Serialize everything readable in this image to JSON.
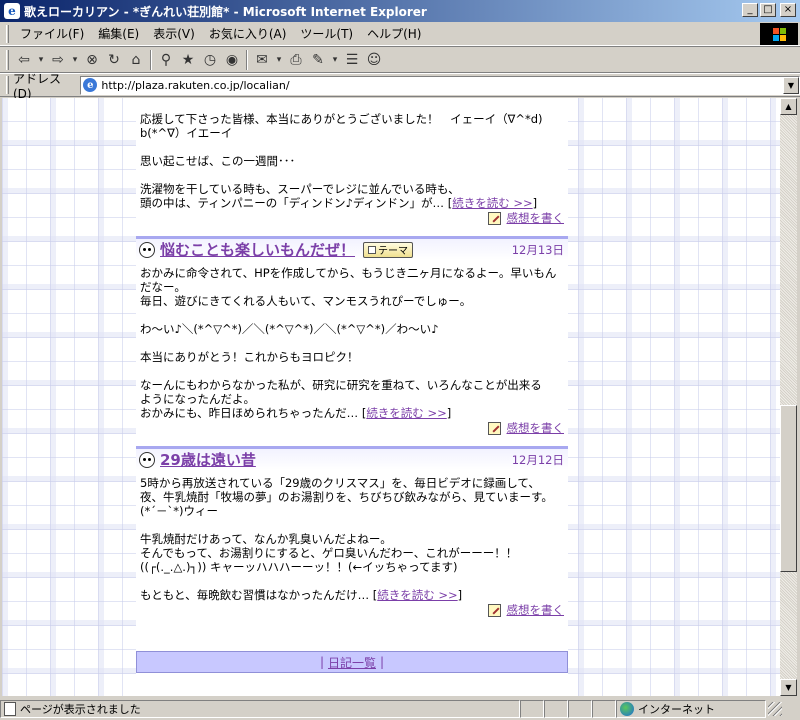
{
  "window": {
    "title": "歌えローカリアン - *ぎんれい荘別館* - Microsoft Internet Explorer",
    "minimize": "_",
    "maximize": "□",
    "close": "×"
  },
  "menu": {
    "items": [
      "ファイル(F)",
      "編集(E)",
      "表示(V)",
      "お気に入り(A)",
      "ツール(T)",
      "ヘルプ(H)"
    ]
  },
  "toolbar": {
    "back": "⇦",
    "forward": "⇨",
    "stop": "⊗",
    "refresh": "↻",
    "home": "⌂",
    "search": "⚲",
    "favorites": "★",
    "history": "◷",
    "media": "◉",
    "mail": "✉",
    "print": "⎙",
    "edit": "✎",
    "discuss": "☰",
    "messenger": "☺",
    "dropdown": "▾"
  },
  "address": {
    "label": "アドレス(D)",
    "url": "http://plaza.rakuten.co.jp/localian/",
    "dropdown": "▼"
  },
  "entries": [
    {
      "lines": [
        "応援して下さった皆様、本当にありがとうございました！　イェーイ（∇^*d)",
        "b(*^∇）イエーイ",
        "",
        "思い起こせば、この一週間･･･",
        "",
        "洗濯物を干している時も、スーパーでレジに並んでいる時も、",
        "頭の中は、ティンパニーの「ディンドン♪ディンドン」が…"
      ],
      "more_label": "続きを読む >>",
      "comment_label": "感想を書く"
    },
    {
      "title": "悩むことも楽しいもんだぜ！",
      "theme_label": "テーマ",
      "date": "12月13日",
      "lines": [
        "おかみに命令されて、HPを作成してから、もうじき二ヶ月になるよー。早いもん",
        "だなー。",
        "毎日、遊びにきてくれる人もいて、マンモスうれぴーでしゅー。",
        "",
        "わ～い♪＼(*^▽^*)／＼(*^▽^*)／＼(*^▽^*)／わ～い♪",
        "",
        "本当にありがとう！これからもヨロピク！",
        "",
        "なーんにもわからなかった私が、研究に研究を重ねて、いろんなことが出来る",
        "ようになったんだよ。",
        "おかみにも、昨日ほめられちゃったんだ…"
      ],
      "more_label": "続きを読む >>",
      "comment_label": "感想を書く"
    },
    {
      "title": "29歳は遠い昔",
      "date": "12月12日",
      "lines": [
        "5時から再放送されている「29歳のクリスマス」を、毎日ビデオに録画して、",
        "夜、牛乳焼酎「牧場の夢」のお湯割りを、ちびちび飲みながら、見ていまーす。",
        "(*´－`*)ウィー",
        "",
        "牛乳焼酎だけあって、なんか乳臭いんだよねー。",
        "そんでもって、お湯割りにすると、ゲロ臭いんだわー、これがーーー！！",
        "((┌(._.△.)┐)) キャーッハハハーーッ！！(←イッちゃってます)",
        "",
        "もともと、毎晩飲む習慣はなかったんだけ…"
      ],
      "more_label": "続きを読む >>",
      "comment_label": "感想を書く"
    }
  ],
  "footer": {
    "sep": "|",
    "diary_list": "日記一覧"
  },
  "status": {
    "text": "ページが表示されました",
    "zone": "インターネット"
  },
  "scroll": {
    "up": "▲",
    "down": "▼",
    "position_fraction": 0.73
  },
  "colors": {
    "link": "#7b3fa8",
    "header_border": "#a8a8f0",
    "footer_bar": "#c8c8ff",
    "titlebar_start": "#0a246a"
  }
}
